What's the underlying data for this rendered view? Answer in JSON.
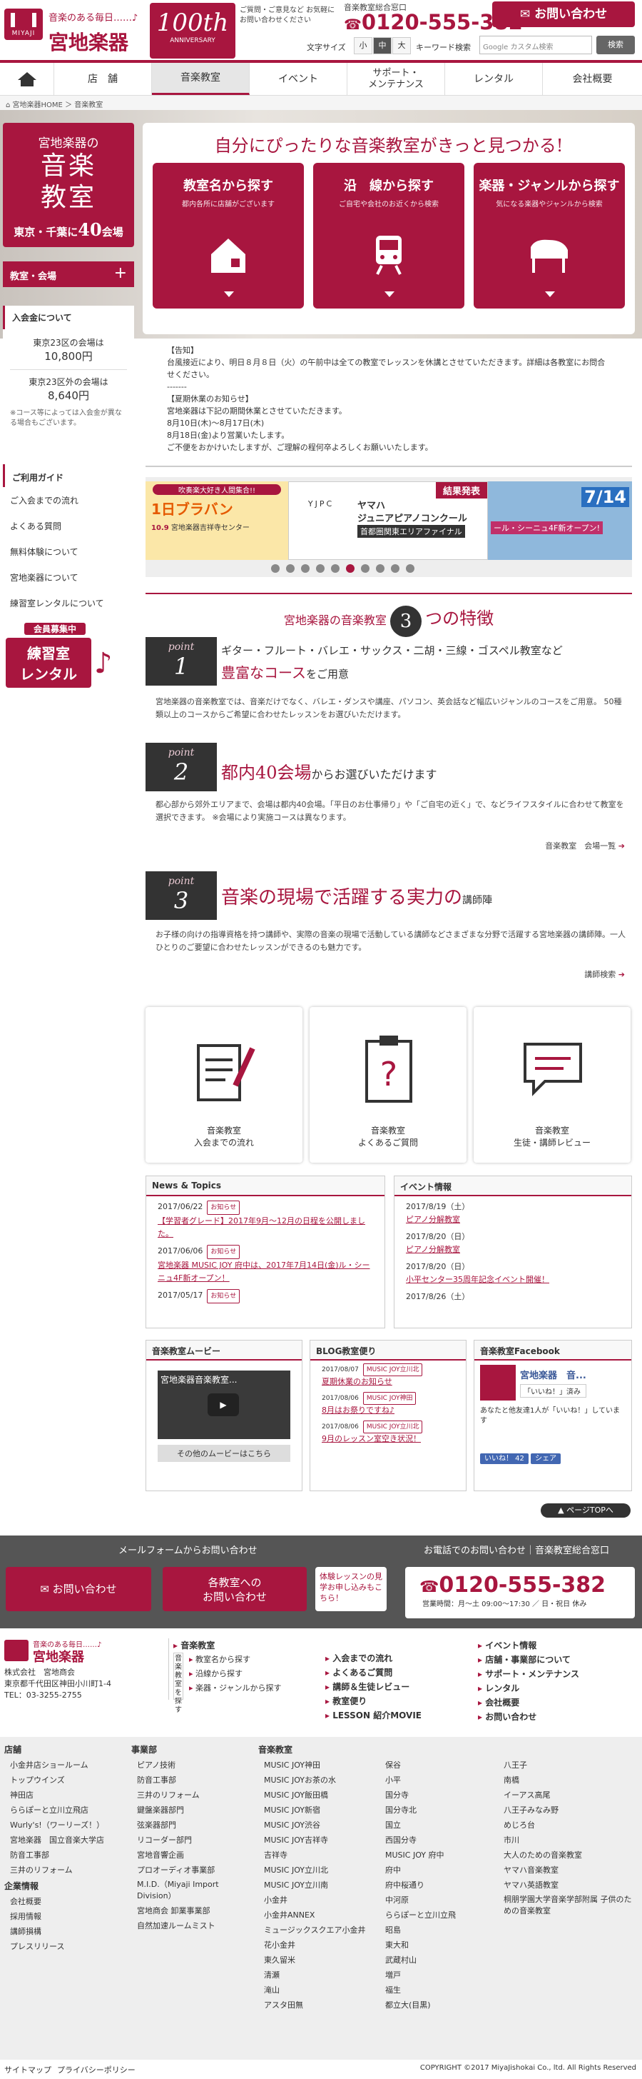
{
  "header": {
    "tagline": "音楽のある毎日……♪",
    "brand": "宮地楽器",
    "logo_text": "MIYAJI",
    "anniversary_big": "100th",
    "anniversary_small": "ANNIVERSARY",
    "support_text": "ご質問・ご意見など お気軽にお問い合わせください",
    "phone_label": "音楽教室総合窓口",
    "phone": "0120-555-382",
    "contact_button": "お問い合わせ",
    "fontsize_label": "文字サイズ",
    "fontsize_small": "小",
    "fontsize_mid": "中",
    "fontsize_large": "大",
    "keyword_label": "キーワード検索",
    "search_placeholder": "Google カスタム検索",
    "search_button": "検索"
  },
  "nav": {
    "items": [
      "店　舗",
      "音楽教室",
      "イベント",
      "サポート・\nメンテナンス",
      "レンタル",
      "会社概要"
    ]
  },
  "breadcrumb": {
    "home": "宮地楽器HOME",
    "sep": "＞",
    "current": "音楽教室"
  },
  "hero": {
    "title": "自分にぴったりな音楽教室がきっと見つかる!",
    "cards": [
      {
        "title": "教室名から探す",
        "sub": "都内各所に店舗がございます"
      },
      {
        "title": "沿　線から探す",
        "sub": "ご自宅や会社のお近くから検索"
      },
      {
        "title": "楽器・ジャンルから探す",
        "sub": "気になる楽器やジャンルから検索"
      }
    ]
  },
  "sidebar": {
    "hero_a": "宮地楽器の",
    "hero_b": "音楽",
    "hero_c": "教室",
    "hero_d": "東京・千葉に",
    "hero_e": "40",
    "hero_f": "会場",
    "nav_title": "教室・会場",
    "fee_title": "入会金について",
    "fee1_label": "東京23区の会場は",
    "fee1_value": "10,800円",
    "fee2_label": "東京23区外の会場は",
    "fee2_value": "8,640円",
    "fee_note": "※コース等によっては入会金が異なる場合もございます。",
    "guide_title": "ご利用ガイド",
    "guide": [
      "ご入会までの流れ",
      "よくある質問",
      "無料体験について",
      "宮地楽器について"
    ],
    "rental_title": "練習室レンタルについて",
    "rental_badge": "会員募集中",
    "rental_big1": "練習室",
    "rental_big2": "レンタル"
  },
  "notice": {
    "lines": [
      "【告知】",
      "台風接近により、明日８月８日（火）の午前中は全ての教室でレッスンを休講とさせていただきます。詳細は各教室にお問合せください。",
      "-------",
      "【夏期休業のお知らせ】",
      "宮地楽器は下記の期間休業とさせていただきます。",
      "8月10日(木)～8月17日(木)",
      "8月18日(金)より営業いたします。",
      "ご不便をおかけいたしますが、ご理解の程何卒よろしくお願いいたします。"
    ]
  },
  "banners": {
    "b1_top": "吹奏楽大好き人間集合!!",
    "b1_main": "1日ブラバン",
    "b1_date": "10.9",
    "b1_place": "宮地楽器吉祥寺センター",
    "b2_brand": "YJPC",
    "b2_l1": "ヤマハ",
    "b2_l2": "ジュニアピアノコンクール",
    "b2_l3": "首都圏関東エリアファイナル",
    "b2_badge": "結果発表",
    "b3_date": "7/14",
    "b3_text": "ール・シーニュ4F新オープン!"
  },
  "features": {
    "title_pre": "宮地楽器の音楽教室",
    "title_num": "3",
    "title_post": "つの特徴",
    "points": [
      {
        "label": "point",
        "num": "1",
        "line1": "ギター・フルート・バレエ・サックス・二胡・三線・ゴスペル教室など",
        "title": "豊富なコース",
        "title_post": "をご用意",
        "body": "宮地楽器の音楽教室では、音楽だけでなく、バレエ・ダンスや講座、パソコン、英会話など幅広いジャンルのコースをご用意。 50種類以上のコースからご希望に合わせたレッスンをお選びいただけます。",
        "link": ""
      },
      {
        "label": "point",
        "num": "2",
        "line1": "",
        "title": "都内40会場",
        "title_post": "からお選びいただけます",
        "body": "都心部から郊外エリアまで、会場は都内40会場。「平日のお仕事帰り」や「ご自宅の近く」で、などライフスタイルに合わせて教室を選択できます。 ※会場により実施コースは異なります。",
        "link": "音楽教室　会場一覧"
      },
      {
        "label": "point",
        "num": "3",
        "line1": "",
        "title": "音楽の現場で活躍する実力の",
        "title_post": "講師陣",
        "body": "お子様の向けの指導資格を持つ講師や、実際の音楽の現場で活動している講師などさまざまな分野で活躍する宮地楽器の講師陣。一人ひとりのご要望に合わせたレッスンができるのも魅力です。",
        "link": "講師検索"
      }
    ]
  },
  "icon_cards": [
    {
      "l1": "音楽教室",
      "l2": "入会までの流れ"
    },
    {
      "l1": "音楽教室",
      "l2": "よくあるご質問"
    },
    {
      "l1": "音楽教室",
      "l2": "生徒・講師レビュー"
    }
  ],
  "news": {
    "title": "News & Topics",
    "tag": "お知らせ",
    "items": [
      {
        "date": "2017/06/22",
        "text": "【学習者グレード】2017年9月～12月の日程を公開しました。"
      },
      {
        "date": "2017/06/06",
        "text": "宮地楽器 MUSIC JOY 府中は、2017年7月14日(金)ル・シーニュ4F新オープン！"
      },
      {
        "date": "2017/05/17",
        "text": ""
      }
    ]
  },
  "events": {
    "title": "イベント情報",
    "items": [
      {
        "date": "2017/8/19（土）",
        "text": "ピアノ分解教室"
      },
      {
        "date": "2017/8/20（日）",
        "text": "ピアノ分解教室"
      },
      {
        "date": "2017/8/20（日）",
        "text": "小平センター35周年記念イベント開催！"
      },
      {
        "date": "2017/8/26（土）",
        "text": ""
      }
    ]
  },
  "movie": {
    "title": "音楽教室ムービー",
    "video_caption": "宮地楽器音楽教室...",
    "more": "その他のムービーはこちら"
  },
  "blog": {
    "title": "BLOG教室便り",
    "items": [
      {
        "date": "2017/08/07",
        "tag": "MUSIC JOY立川北",
        "text": "夏期休業のお知らせ"
      },
      {
        "date": "2017/08/06",
        "tag": "MUSIC JOY神田",
        "text": "8月はお祭りですね♪"
      },
      {
        "date": "2017/08/06",
        "tag": "MUSIC JOY立川北",
        "text": "9月のレッスン室空き状況！"
      }
    ]
  },
  "facebook": {
    "title": "音楽教室Facebook",
    "page": "宮地楽器　音...",
    "like_btn": "「いいね！」済み",
    "friends": "あなたと他友達1人が「いいね！」しています",
    "like": "いいね！ 42",
    "share": "シェア"
  },
  "pagetop": "▲ ページTOPへ",
  "contact": {
    "mail_title": "メールフォームからお問い合わせ",
    "phone_title": "お電話でのお問い合わせ｜音楽教室総合窓口",
    "btn1": "お問い合わせ",
    "btn2_l1": "各教室への",
    "btn2_l2": "お問い合わせ",
    "trial": "体験レッスンの見学お申し込みもこちら！",
    "phone": "0120-555-382",
    "hours": "営業時間：月～土 09:00～17:30 ／ 日・祝日 休み"
  },
  "footer": {
    "company": "株式会社　宮地商会",
    "address": "東京都千代田区神田小川町1-4",
    "tel": "TEL：03-3255-2755",
    "school_title": "音楽教室",
    "school_label": "音楽教室を探す",
    "school_links": [
      "教室名から探す",
      "沿線から探す",
      "楽器・ジャンルから探す"
    ],
    "mid_links": [
      "入会までの流れ",
      "よくあるご質問",
      "講師＆生徒レビュー",
      "教室便り",
      "LESSON 紹介MOVIE"
    ],
    "right_links": [
      "イベント情報",
      "店舗・事業部について",
      "サポート・メンテナンス",
      "レンタル",
      "会社概要",
      "お問い合わせ"
    ],
    "col_store_title": "店舗",
    "col_store": [
      "小金井店ショールーム",
      "トップウインズ",
      "神田店",
      "ららぽーと立川立飛店",
      "Wurly's!（ワーリーズ！）",
      "宮地楽器　国立音楽大学店",
      "防音工事部",
      "三井のリフォーム"
    ],
    "col_corp_title": "企業情報",
    "col_corp": [
      "会社概要",
      "採用情報",
      "講師損構",
      "プレスリリース"
    ],
    "col_biz_title": "事業部",
    "col_biz": [
      "ピアノ技術",
      "防音工事部",
      "三井のリフォーム",
      "鍵盤楽器部門",
      "弦楽器部門",
      "リコーダー部門",
      "宮地音響企画",
      "プロオーディオ事業部",
      "M.I.D.（Miyaji Import Division）",
      "宮地商会 卸業事業部",
      "自然加速ルームミスト"
    ],
    "col_school_title": "音楽教室",
    "col_school1": [
      "MUSIC JOY神田",
      "MUSIC JOYお茶の水",
      "MUSIC JOY飯田橋",
      "MUSIC JOY新宿",
      "MUSIC JOY渋谷",
      "MUSIC JOY吉祥寺",
      "吉祥寺",
      "MUSIC JOY立川北",
      "MUSIC JOY立川南",
      "小金井",
      "小金井ANNEX",
      "ミュージックスクエア小金井",
      "花小金井",
      "東久留米",
      "清瀬",
      "滝山",
      "アスタ田無"
    ],
    "col_school2": [
      "保谷",
      "小平",
      "国分寺",
      "国分寺北",
      "国立",
      "西国分寺",
      "MUSIC JOY 府中",
      "府中",
      "府中桜通り",
      "中河原",
      "ららぽーと立川立飛",
      "昭島",
      "東大和",
      "武蔵村山",
      "増戸",
      "福生",
      "都立大(目黒)"
    ],
    "col_school3": [
      "八王子",
      "南橋",
      "イーアス高尾",
      "八王子みなみ野",
      "めじろ台",
      "市川",
      "大人のための音楽教室",
      "ヤマハ音楽教室",
      "ヤマハ英語教室",
      "桐朋学園大学音楽学部附属 子供のための音楽教室"
    ],
    "sitemap": "サイトマップ",
    "privacy": "プライバシーポリシー",
    "copyright": "COPYRIGHT ©2017 MiyaJishokai Co., ltd. All Rights Reserved"
  },
  "colors": {
    "accent": "#a8163f",
    "dark": "#333333",
    "band": "#555555"
  }
}
